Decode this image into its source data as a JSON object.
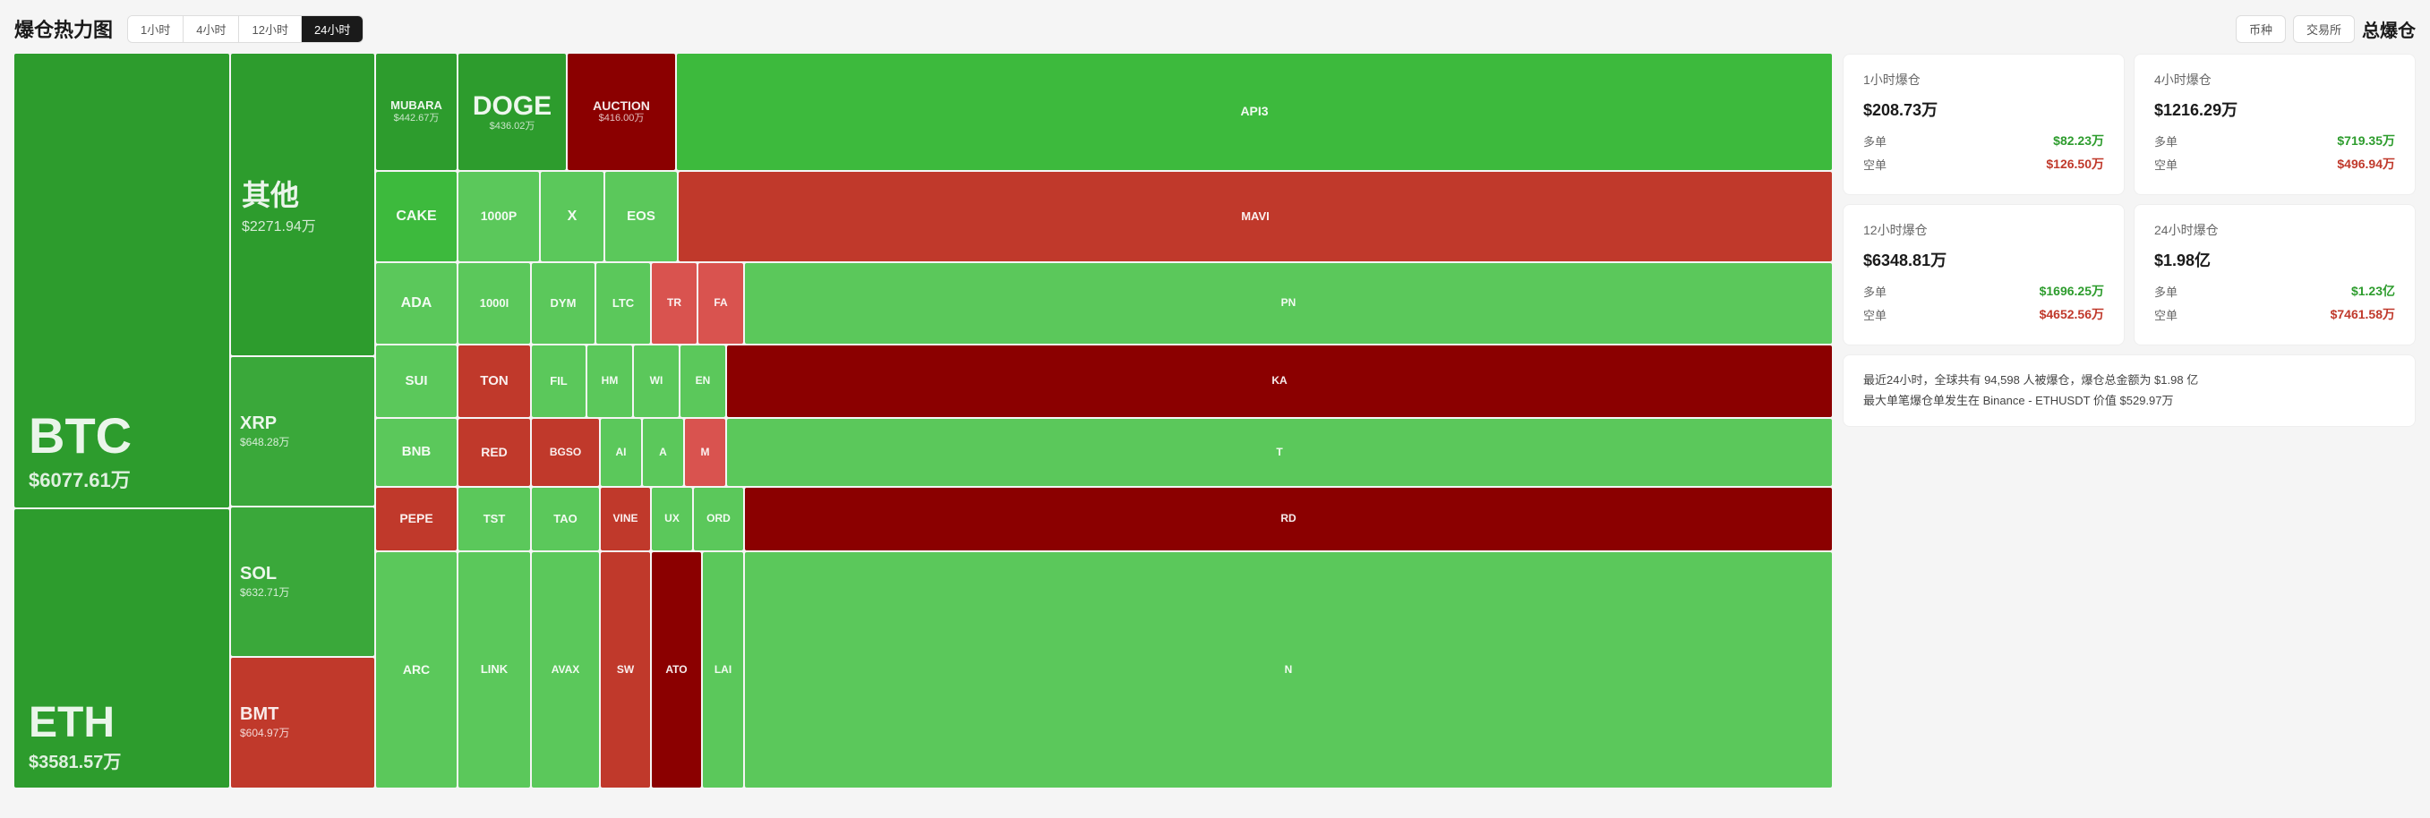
{
  "header": {
    "title": "爆仓热力图",
    "tabs": [
      {
        "label": "1小时",
        "active": false
      },
      {
        "label": "4小时",
        "active": false
      },
      {
        "label": "12小时",
        "active": false
      },
      {
        "label": "24小时",
        "active": true
      }
    ],
    "toggles": [
      {
        "label": "币种",
        "active": false
      },
      {
        "label": "交易所",
        "active": false
      }
    ],
    "section_title": "总爆仓"
  },
  "heatmap": {
    "btc": {
      "symbol": "BTC",
      "value": "$6077.61万"
    },
    "eth": {
      "symbol": "ETH",
      "value": "$3581.57万"
    },
    "qita": {
      "symbol": "其他",
      "value": "$2271.94万"
    },
    "xrp": {
      "symbol": "XRP",
      "value": "$648.28万"
    },
    "sol": {
      "symbol": "SOL",
      "value": "$632.71万"
    },
    "bmt": {
      "symbol": "BMT",
      "value": "$604.97万"
    }
  },
  "stats": {
    "h1": {
      "title": "1小时爆仓",
      "total": "$208.73万",
      "long": "$82.23万",
      "short": "$126.50万"
    },
    "h4": {
      "title": "4小时爆仓",
      "total": "$1216.29万",
      "long": "$719.35万",
      "short": "$496.94万"
    },
    "h12": {
      "title": "12小时爆仓",
      "total": "$6348.81万",
      "long": "$1696.25万",
      "short": "$4652.56万"
    },
    "h24": {
      "title": "24小时爆仓",
      "total": "$1.98亿",
      "long": "$1.23亿",
      "short": "$7461.58万"
    },
    "long_label": "多单",
    "short_label": "空单"
  },
  "summary": {
    "line1": "最近24小时，全球共有 94,598 人被爆仓，爆仓总金额为 $1.98 亿",
    "line2": "最大单笔爆仓单发生在 Binance - ETHUSDT 价值 $529.97万"
  }
}
